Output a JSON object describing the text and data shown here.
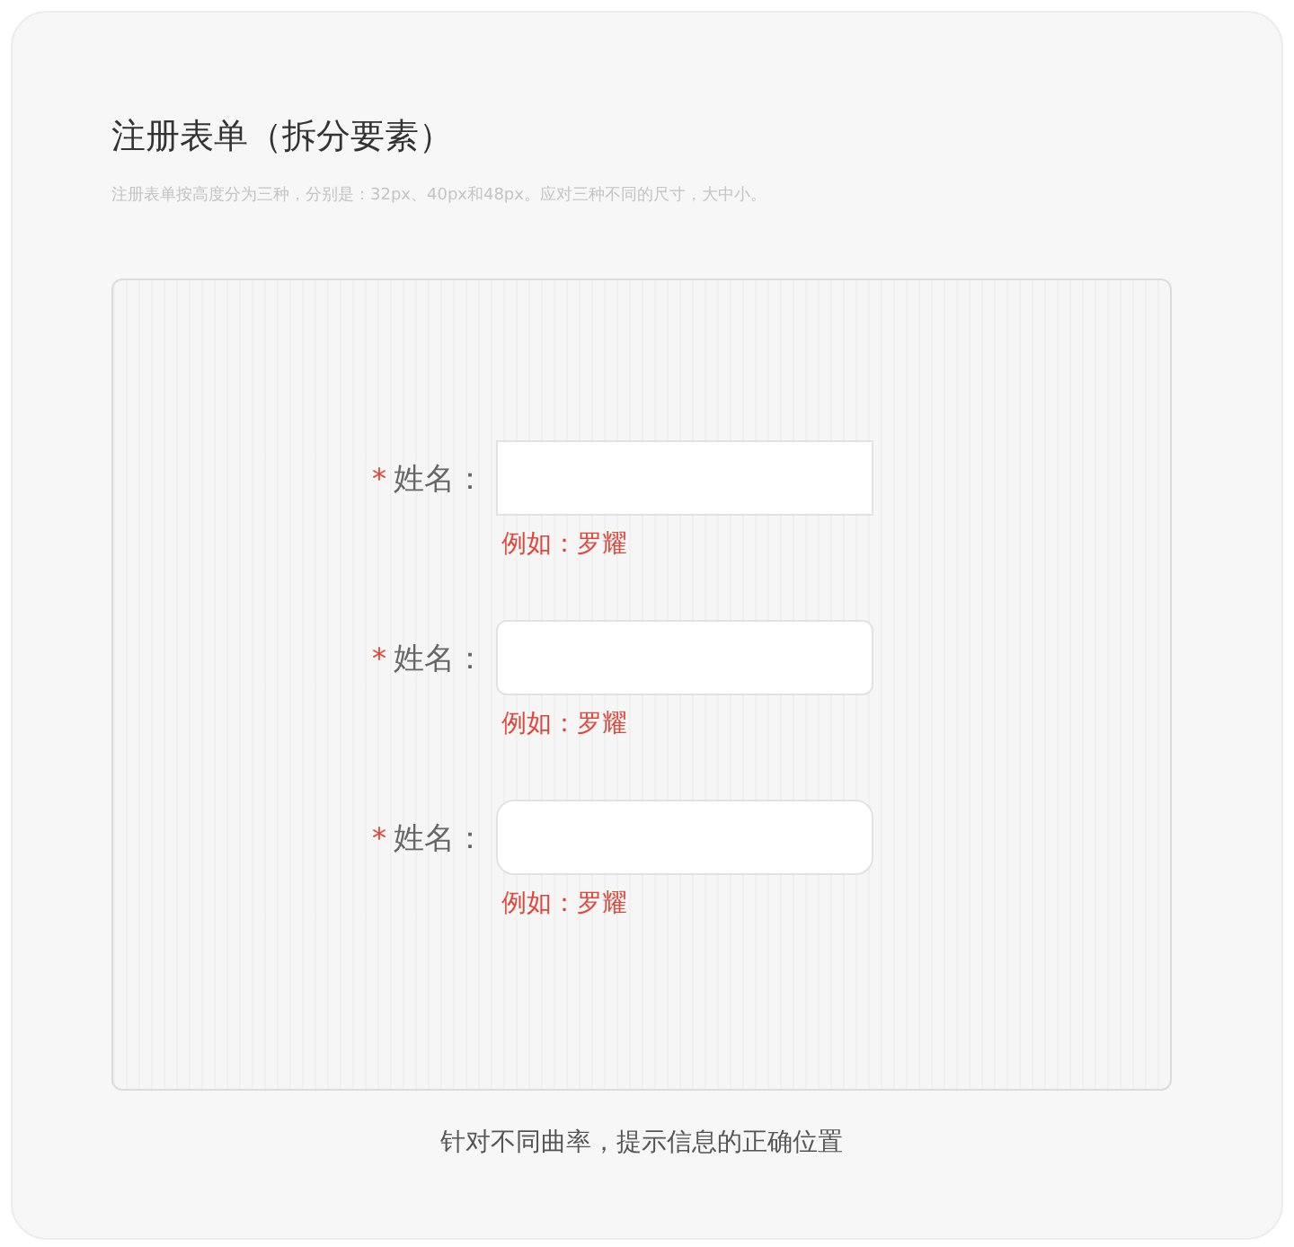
{
  "title": "注册表单（拆分要素）",
  "subtitle": "注册表单按高度分为三种，分别是：32px、40px和48px。应对三种不同的尺寸，大中小。",
  "fields": [
    {
      "required_mark": "*",
      "label": "姓名：",
      "hint": "例如：罗耀",
      "kind": "square"
    },
    {
      "required_mark": "*",
      "label": "姓名：",
      "hint": "例如：罗耀",
      "kind": "rounded"
    },
    {
      "required_mark": "*",
      "label": "姓名：",
      "hint": "例如：罗耀",
      "kind": "round"
    }
  ],
  "caption": "针对不同曲率，提示信息的正确位置"
}
